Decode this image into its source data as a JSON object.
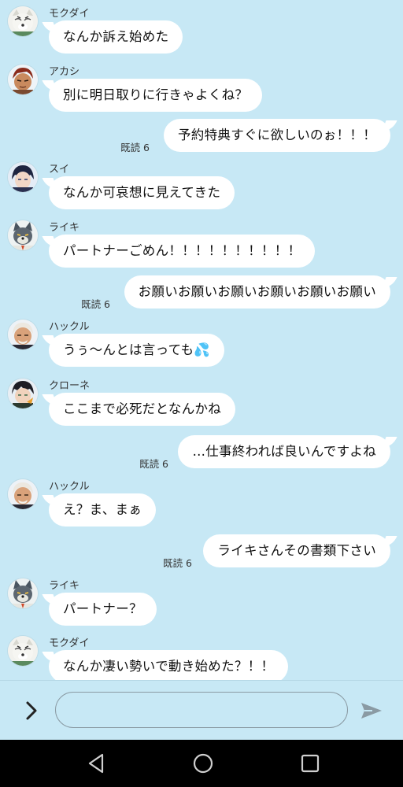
{
  "colors": {
    "chat_background": "#c7e8f5",
    "bubble": "#ffffff",
    "navbar": "#000000"
  },
  "messages": [
    {
      "type": "incoming",
      "sender": "モクダイ",
      "text": "なんか訴え始めた",
      "avatar": "tiger-avatar"
    },
    {
      "type": "incoming",
      "sender": "アカシ",
      "text": "別に明日取りに行きゃよくね？",
      "avatar": "red-hair-avatar"
    },
    {
      "type": "outgoing",
      "read": "既読 6",
      "text": "予約特典すぐに欲しいのぉ！！！"
    },
    {
      "type": "incoming",
      "sender": "スイ",
      "text": "なんか可哀想に見えてきた",
      "avatar": "dark-hair-avatar"
    },
    {
      "type": "incoming",
      "sender": "ライキ",
      "text": "パートナーごめん！！！！！！！！！！",
      "avatar": "wolf-avatar"
    },
    {
      "type": "outgoing",
      "read": "既読 6",
      "text": "お願いお願いお願いお願いお願いお願い"
    },
    {
      "type": "incoming",
      "sender": "ハックル",
      "text": "うぅ〜んとは言っても💦",
      "avatar": "white-hair-avatar"
    },
    {
      "type": "incoming",
      "sender": "クローネ",
      "text": "ここまで必死だとなんかね",
      "avatar": "raven-hair-avatar"
    },
    {
      "type": "outgoing",
      "read": "既読 6",
      "text": "…仕事終われば良いんですよね"
    },
    {
      "type": "incoming",
      "sender": "ハックル",
      "text": "え？ま、まぁ",
      "avatar": "white-hair-avatar"
    },
    {
      "type": "outgoing",
      "read": "既読 6",
      "text": "ライキさんその書類下さい"
    },
    {
      "type": "incoming",
      "sender": "ライキ",
      "text": "パートナー？",
      "avatar": "wolf-avatar"
    },
    {
      "type": "incoming",
      "sender": "モクダイ",
      "text": "なんか凄い勢いで動き始めた？！！",
      "avatar": "tiger-avatar"
    }
  ],
  "composer": {
    "input_value": "",
    "input_placeholder": ""
  }
}
